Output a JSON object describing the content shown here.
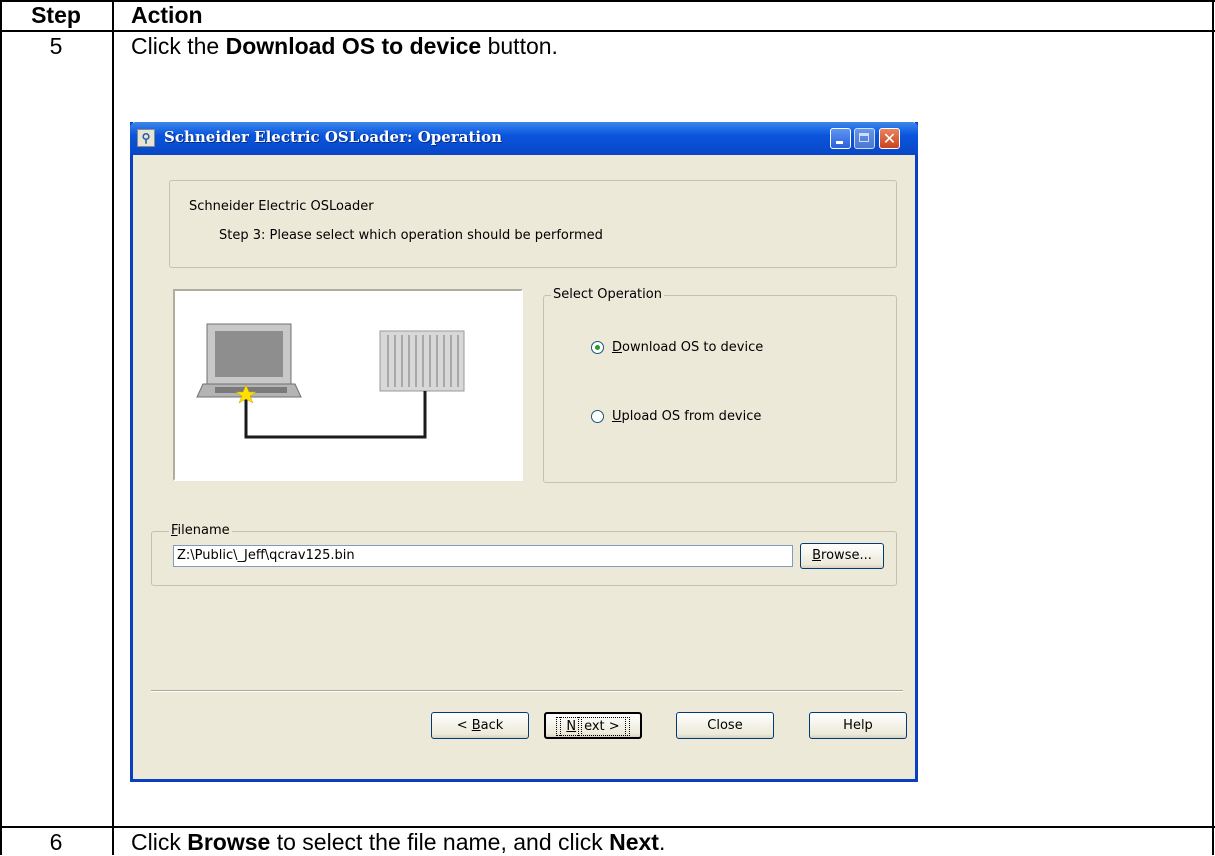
{
  "table": {
    "header_step": "Step",
    "header_action": "Action",
    "rows": [
      {
        "step": "5",
        "text_before": "Click the ",
        "text_bold": "Download OS to device",
        "text_after": " button."
      },
      {
        "step": "6",
        "text_a": "Click ",
        "bold_a": "Browse",
        "text_b": " to select the file name, and click ",
        "bold_b": "Next",
        "text_c": "."
      }
    ]
  },
  "dialog": {
    "title": "Schneider Electric OSLoader: Operation",
    "header_title": "Schneider Electric OSLoader",
    "header_step": "Step 3: Please select which operation should be performed",
    "select_group": "Select Operation",
    "options": [
      {
        "pre": "",
        "key": "D",
        "rest": "ownload OS to device",
        "selected": true
      },
      {
        "pre": "",
        "key": "U",
        "rest": "pload OS from device",
        "selected": false
      }
    ],
    "filename_group_key": "F",
    "filename_group_rest": "ilename",
    "filename_value": "Z:\\Public\\_Jeff\\qcrav125.bin",
    "browse_key": "B",
    "browse_rest": "rowse...",
    "buttons": {
      "back_pre": "< ",
      "back_key": "B",
      "back_rest": "ack",
      "next_key": "N",
      "next_rest": "ext >",
      "close": "Close",
      "help": "Help"
    }
  },
  "colors": {
    "titlebar": "#0a55dd",
    "dialog_face": "#ece9d8",
    "radio_dot": "#21a121",
    "cable": "#1a1a1a",
    "connector": "#ffe000"
  }
}
